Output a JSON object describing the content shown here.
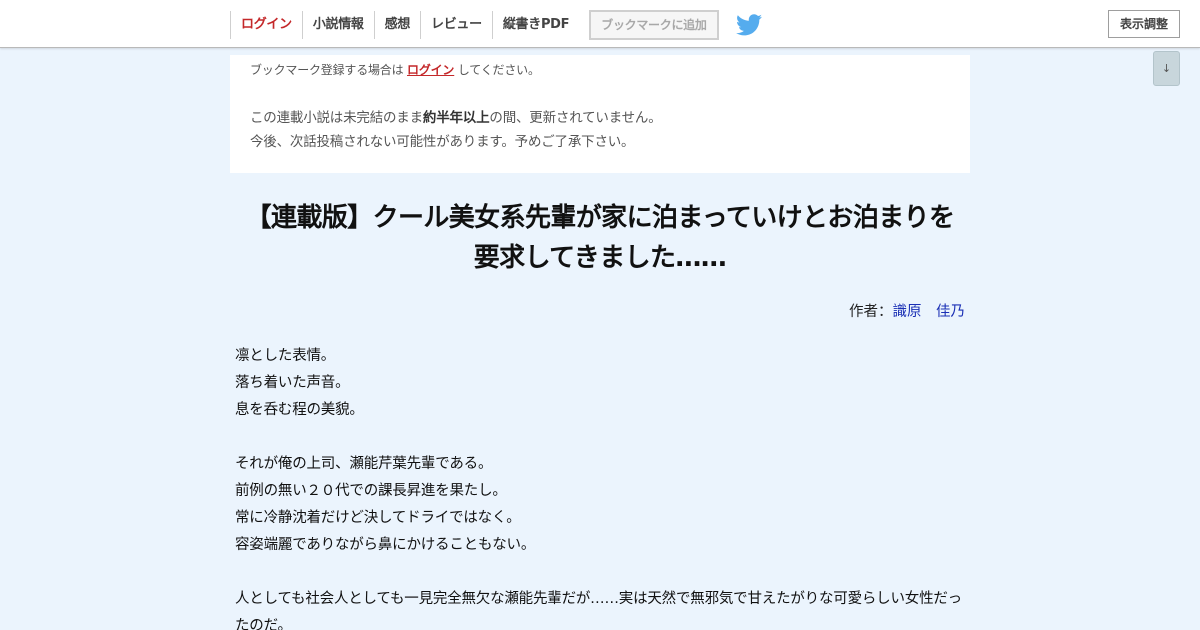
{
  "header": {
    "nav": {
      "login": "ログイン",
      "novel_info": "小説情報",
      "impressions": "感想",
      "review": "レビュー",
      "vertical_pdf": "縦書きPDF"
    },
    "bookmark_button": "ブックマークに追加",
    "twitter_icon": "twitter-bird",
    "display_settings": "表示調整",
    "scroll_down": "↓"
  },
  "notice": {
    "bookmark_prefix": "ブックマーク登録する場合は",
    "bookmark_login": "ログイン",
    "bookmark_suffix": "してください。",
    "warn_line1_a": "この連載小説は未完結のまま",
    "warn_line1_b": "約半年以上",
    "warn_line1_c": "の間、更新されていません。",
    "warn_line2": "今後、次話投稿されない可能性があります。予めご了承下さい。"
  },
  "novel": {
    "title": "【連載版】クール美女系先輩が家に泊まっていけとお泊まりを要求してきました……",
    "author_label": "作者：",
    "author_name": "識原　佳乃",
    "body": [
      "凛とした表情。",
      "落ち着いた声音。",
      "息を呑む程の美貌。",
      "",
      "それが俺の上司、瀬能芹葉先輩である。",
      "前例の無い２０代での課長昇進を果たし。",
      "常に冷静沈着だけど決してドライではなく。",
      "容姿端麗でありながら鼻にかけることもない。",
      "",
      "人としても社会人としても一見完全無欠な瀬能先輩だが……実は天然で無邪気で甘えたがりな可愛らしい女性だったのだ。"
    ]
  },
  "colors": {
    "background": "#ebf4fd",
    "login_red": "#c4282a",
    "author_link": "#1a2fb5",
    "twitter_blue": "#55acee"
  }
}
